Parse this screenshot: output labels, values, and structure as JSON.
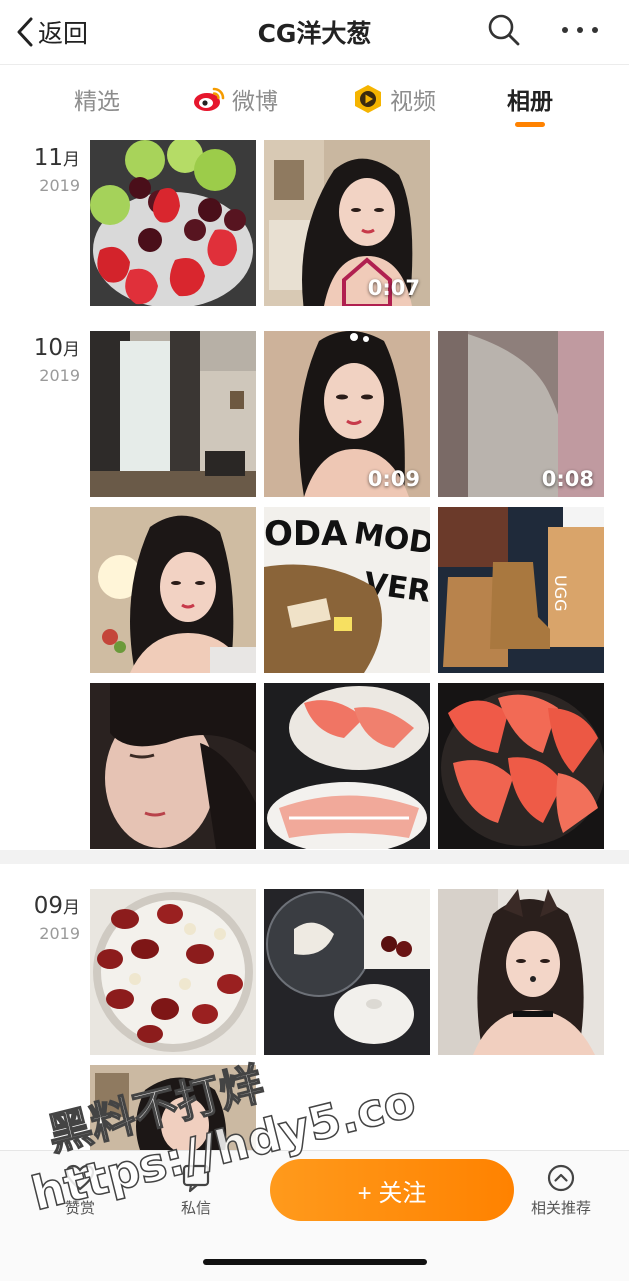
{
  "header": {
    "back_label": "返回",
    "title": "CG洋大葱"
  },
  "tabs": [
    {
      "label": "精选",
      "icon": "none",
      "active": false
    },
    {
      "label": "微博",
      "icon": "weibo-icon",
      "active": false
    },
    {
      "label": "视频",
      "icon": "video-icon",
      "active": false
    },
    {
      "label": "相册",
      "icon": "none",
      "active": true
    }
  ],
  "album": [
    {
      "month": "11",
      "month_suffix": "月",
      "year": "2019",
      "items": [
        {
          "name": "photo-fruit-bowl",
          "kind": "photo"
        },
        {
          "name": "video-portrait",
          "kind": "video",
          "duration": "0:07"
        }
      ]
    },
    {
      "month": "10",
      "month_suffix": "月",
      "year": "2019",
      "items": [
        {
          "name": "photo-hotel-room",
          "kind": "photo"
        },
        {
          "name": "video-selfie",
          "kind": "video",
          "duration": "0:09"
        },
        {
          "name": "video-grey-dress",
          "kind": "video",
          "duration": "0:08"
        },
        {
          "name": "photo-selfie-room",
          "kind": "photo"
        },
        {
          "name": "photo-vero-moda-bag",
          "kind": "photo"
        },
        {
          "name": "photo-ugg-boots",
          "kind": "photo"
        },
        {
          "name": "photo-face-closeup",
          "kind": "photo"
        },
        {
          "name": "photo-sliced-fish",
          "kind": "photo"
        },
        {
          "name": "photo-pomelo",
          "kind": "photo"
        }
      ]
    },
    {
      "month": "09",
      "month_suffix": "月",
      "year": "2019",
      "items": [
        {
          "name": "photo-red-dates-soup",
          "kind": "photo"
        },
        {
          "name": "photo-glass-bowls",
          "kind": "photo"
        },
        {
          "name": "photo-cat-filter-selfie",
          "kind": "photo"
        },
        {
          "name": "photo-portrait-bottom",
          "kind": "photo"
        }
      ]
    }
  ],
  "bottom_bar": {
    "like_label": "赞赏",
    "message_label": "私信",
    "follow_label": "+ 关注",
    "recommend_label": "相关推荐"
  },
  "watermark": {
    "line1": "黑料不打烊",
    "line2": "https://hdy5.co"
  },
  "colors": {
    "accent": "#ff8200",
    "weibo_red": "#e6162d",
    "video_gold": "#f5b400"
  }
}
